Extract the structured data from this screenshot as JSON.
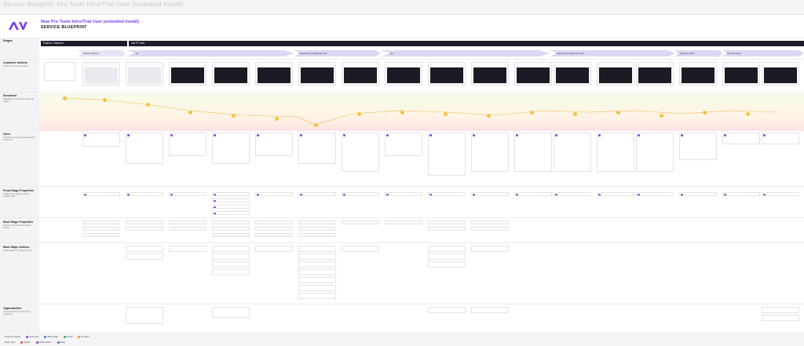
{
  "page_title": "Service Blueprint: Pro Tools Intro/Trial User (extended Install)",
  "header": {
    "subtitle": "New Pro Tools Intro/Trial User (extended Install)",
    "title": "SERVICE BLUEPRINT"
  },
  "rows": [
    {
      "label": "Stages",
      "desc": ""
    },
    {
      "label": "Customer Actions",
      "desc": "Actions the customer takes"
    },
    {
      "label": "Sentiment",
      "desc": "Highlights for sentiment across all stages"
    },
    {
      "label": "Voice",
      "desc": "Verbatim or supporting quotes from customers"
    },
    {
      "label": "Front Stage Properties",
      "desc": "Artifacts the customer directly interacts with"
    },
    {
      "label": "Back Stage Properties",
      "desc": "Systems and teams behind the scenes"
    },
    {
      "label": "Back Stage Actions",
      "desc": "Actions taken by internal teams"
    },
    {
      "label": "Opportunities",
      "desc": "Areas identified to improve the experience"
    }
  ],
  "phases": [
    {
      "label": "Explore / Discover"
    },
    {
      "label": "Get PT Intro"
    }
  ],
  "stages": [
    {
      "label": "Explore Options"
    },
    {
      "label": "Sign Up"
    },
    {
      "label": "Download & Install Avid Link"
    },
    {
      "label": "Activate"
    },
    {
      "label": "Download and Install Pro Tools"
    },
    {
      "label": "Start Pro Tools"
    },
    {
      "label": "Use Pro Tools"
    }
  ],
  "legend": {
    "property_types_label": "Property Types",
    "property_types": [
      "Avid.com",
      "Web Page",
      "Email",
      "Product"
    ],
    "data_types_label": "Data Type",
    "data_types": [
      "Quote",
      "Observation",
      "Data"
    ],
    "colors": {
      "purple": "#7b3fe4",
      "blue": "#3b7dd8",
      "green": "#3aa56b",
      "orange": "#f08a2c",
      "red": "#d94a4a"
    }
  }
}
